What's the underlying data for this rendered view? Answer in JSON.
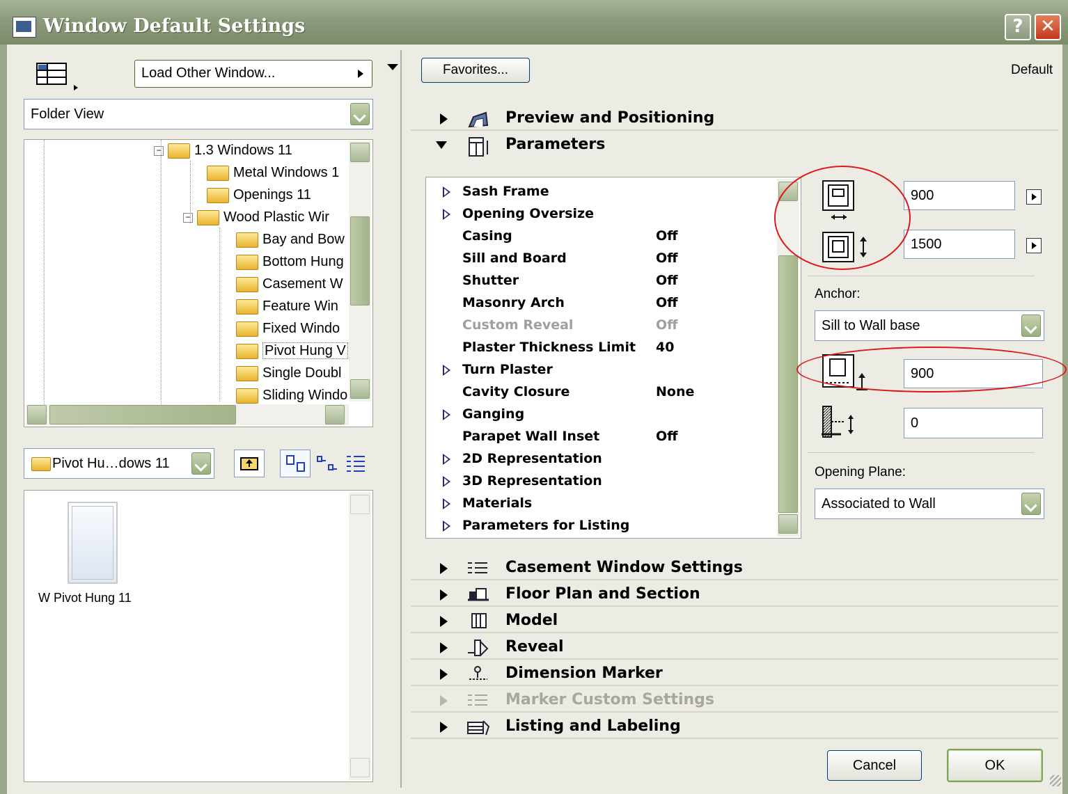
{
  "window": {
    "title": "Window Default Settings",
    "help_label": "?",
    "close_label": "✕"
  },
  "left": {
    "load_other": "Load Other Window...",
    "view_select": "Folder View",
    "tree": [
      {
        "label": "1.3 Windows 11"
      },
      {
        "label": "Metal Windows 1"
      },
      {
        "label": "Openings 11"
      },
      {
        "label": "Wood Plastic Wir"
      },
      {
        "label": "Bay and Bow"
      },
      {
        "label": "Bottom Hung"
      },
      {
        "label": "Casement W"
      },
      {
        "label": "Feature Win"
      },
      {
        "label": "Fixed Windo"
      },
      {
        "label": "Pivot Hung V"
      },
      {
        "label": "Single Doubl"
      },
      {
        "label": "Sliding Windo"
      }
    ],
    "folder_select": "Pivot Hu…dows 11",
    "preview_item": "W Pivot Hung 11"
  },
  "right": {
    "favorites_label": "Favorites...",
    "default_label": "Default",
    "sections_top": [
      {
        "label": "Preview and Positioning",
        "icon": "preview-icon"
      },
      {
        "label": "Parameters",
        "icon": "parameters-icon"
      }
    ],
    "params": [
      {
        "name": "Sash Frame",
        "value": "",
        "expandable": true
      },
      {
        "name": "Opening Oversize",
        "value": "",
        "expandable": true
      },
      {
        "name": "Casing",
        "value": "Off"
      },
      {
        "name": "Sill and Board",
        "value": "Off"
      },
      {
        "name": "Shutter",
        "value": "Off"
      },
      {
        "name": "Masonry Arch",
        "value": "Off"
      },
      {
        "name": "Custom Reveal",
        "value": "Off",
        "disabled": true
      },
      {
        "name": "Plaster Thickness Limit",
        "value": "40"
      },
      {
        "name": "Turn Plaster",
        "value": "",
        "expandable": true
      },
      {
        "name": "Cavity Closure",
        "value": "None"
      },
      {
        "name": "Ganging",
        "value": "",
        "expandable": true
      },
      {
        "name": "Parapet Wall Inset",
        "value": "Off"
      },
      {
        "name": "2D Representation",
        "value": "",
        "expandable": true
      },
      {
        "name": "3D Representation",
        "value": "",
        "expandable": true
      },
      {
        "name": "Materials",
        "value": "",
        "expandable": true
      },
      {
        "name": "Parameters for Listing",
        "value": "",
        "expandable": true
      }
    ],
    "width": "900",
    "height": "1500",
    "anchor_label": "Anchor:",
    "anchor_value": "Sill to Wall base",
    "sill_height": "900",
    "offset": "0",
    "opening_plane_label": "Opening Plane:",
    "opening_plane_value": "Associated to Wall",
    "sections_bottom": [
      {
        "label": "Casement Window Settings",
        "icon": "casement-settings-icon"
      },
      {
        "label": "Floor Plan and Section",
        "icon": "floor-plan-icon"
      },
      {
        "label": "Model",
        "icon": "model-icon"
      },
      {
        "label": "Reveal",
        "icon": "reveal-icon"
      },
      {
        "label": "Dimension Marker",
        "icon": "dimension-marker-icon"
      },
      {
        "label": "Marker Custom Settings",
        "icon": "marker-settings-icon",
        "disabled": true
      },
      {
        "label": "Listing and Labeling",
        "icon": "listing-icon"
      }
    ],
    "cancel_label": "Cancel",
    "ok_label": "OK"
  },
  "colors": {
    "titlebar": "#8c9a7c",
    "annotation": "#e0161a"
  }
}
